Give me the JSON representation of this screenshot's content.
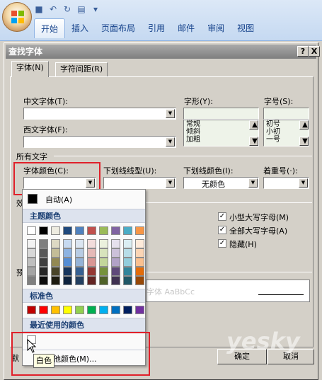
{
  "ribbon": {
    "tabs": [
      "开始",
      "插入",
      "页面布局",
      "引用",
      "邮件",
      "审阅",
      "视图"
    ],
    "active_tab": 0
  },
  "dialog": {
    "title": "查找字体",
    "help": "?",
    "close": "X",
    "tabs": [
      "字体(N)",
      "字符间距(R)"
    ],
    "chinese_font_label": "中文字体(T):",
    "western_font_label": "西文字体(F):",
    "style_label": "字形(Y):",
    "size_label": "字号(S):",
    "style_options": [
      "常规",
      "倾斜",
      "加粗"
    ],
    "size_options": [
      "初号",
      "小初",
      "一号"
    ],
    "all_text_label": "所有文字",
    "font_color_label": "字体颜色(C):",
    "underline_style_label": "下划线线型(U):",
    "underline_color_label": "下划线颜色(I):",
    "underline_color_value": "无颜色",
    "emphasis_label": "着重号(·):",
    "effects_label": "效",
    "preview_label": "预",
    "preview_text": "字体 AaBbCc",
    "checkboxes": [
      {
        "label": "小型大写字母(M)",
        "checked": true
      },
      {
        "label": "全部大写字母(A)",
        "checked": true
      },
      {
        "label": "隐藏(H)",
        "checked": true
      }
    ],
    "ok": "确定",
    "cancel": "取消",
    "default_fragment": "默"
  },
  "color_menu": {
    "automatic": "自动(A)",
    "theme_colors": "主题颜色",
    "standard_colors": "标准色",
    "recent_colors": "最近使用的颜色",
    "more_colors": "其他颜色(M)...",
    "tooltip": "白色",
    "theme_top": [
      "#ffffff",
      "#000000",
      "#eeece1",
      "#1f497d",
      "#4f81bd",
      "#c0504d",
      "#9bbb59",
      "#8064a2",
      "#4bacc6",
      "#f79646"
    ],
    "theme_shades": [
      [
        "#f2f2f2",
        "#7f7f7f",
        "#ddd9c3",
        "#c6d9f0",
        "#dbe5f1",
        "#f2dcdb",
        "#ebf1dd",
        "#e5e0ec",
        "#dbeef3",
        "#fdeada"
      ],
      [
        "#d8d8d8",
        "#595959",
        "#c4bd97",
        "#8db3e2",
        "#b8cce4",
        "#e5b9b7",
        "#d7e3bc",
        "#ccc1d9",
        "#b7dde8",
        "#fbd5b5"
      ],
      [
        "#bfbfbf",
        "#3f3f3f",
        "#938953",
        "#548dd4",
        "#95b3d7",
        "#d99694",
        "#c3d69b",
        "#b2a2c7",
        "#92cddc",
        "#fac08f"
      ],
      [
        "#a5a5a5",
        "#262626",
        "#494429",
        "#17365d",
        "#366092",
        "#953734",
        "#76923c",
        "#5f497a",
        "#31859b",
        "#e36c09"
      ],
      [
        "#7f7f7f",
        "#0c0c0c",
        "#1d1b10",
        "#0f243e",
        "#244061",
        "#632423",
        "#4f6128",
        "#3f3151",
        "#205867",
        "#974806"
      ]
    ],
    "standard": [
      "#c00000",
      "#ff0000",
      "#ffc000",
      "#ffff00",
      "#92d050",
      "#00b050",
      "#00b0f0",
      "#0070c0",
      "#002060",
      "#7030a0"
    ],
    "recent": [
      "#ffffff"
    ]
  },
  "watermark": "yesky"
}
